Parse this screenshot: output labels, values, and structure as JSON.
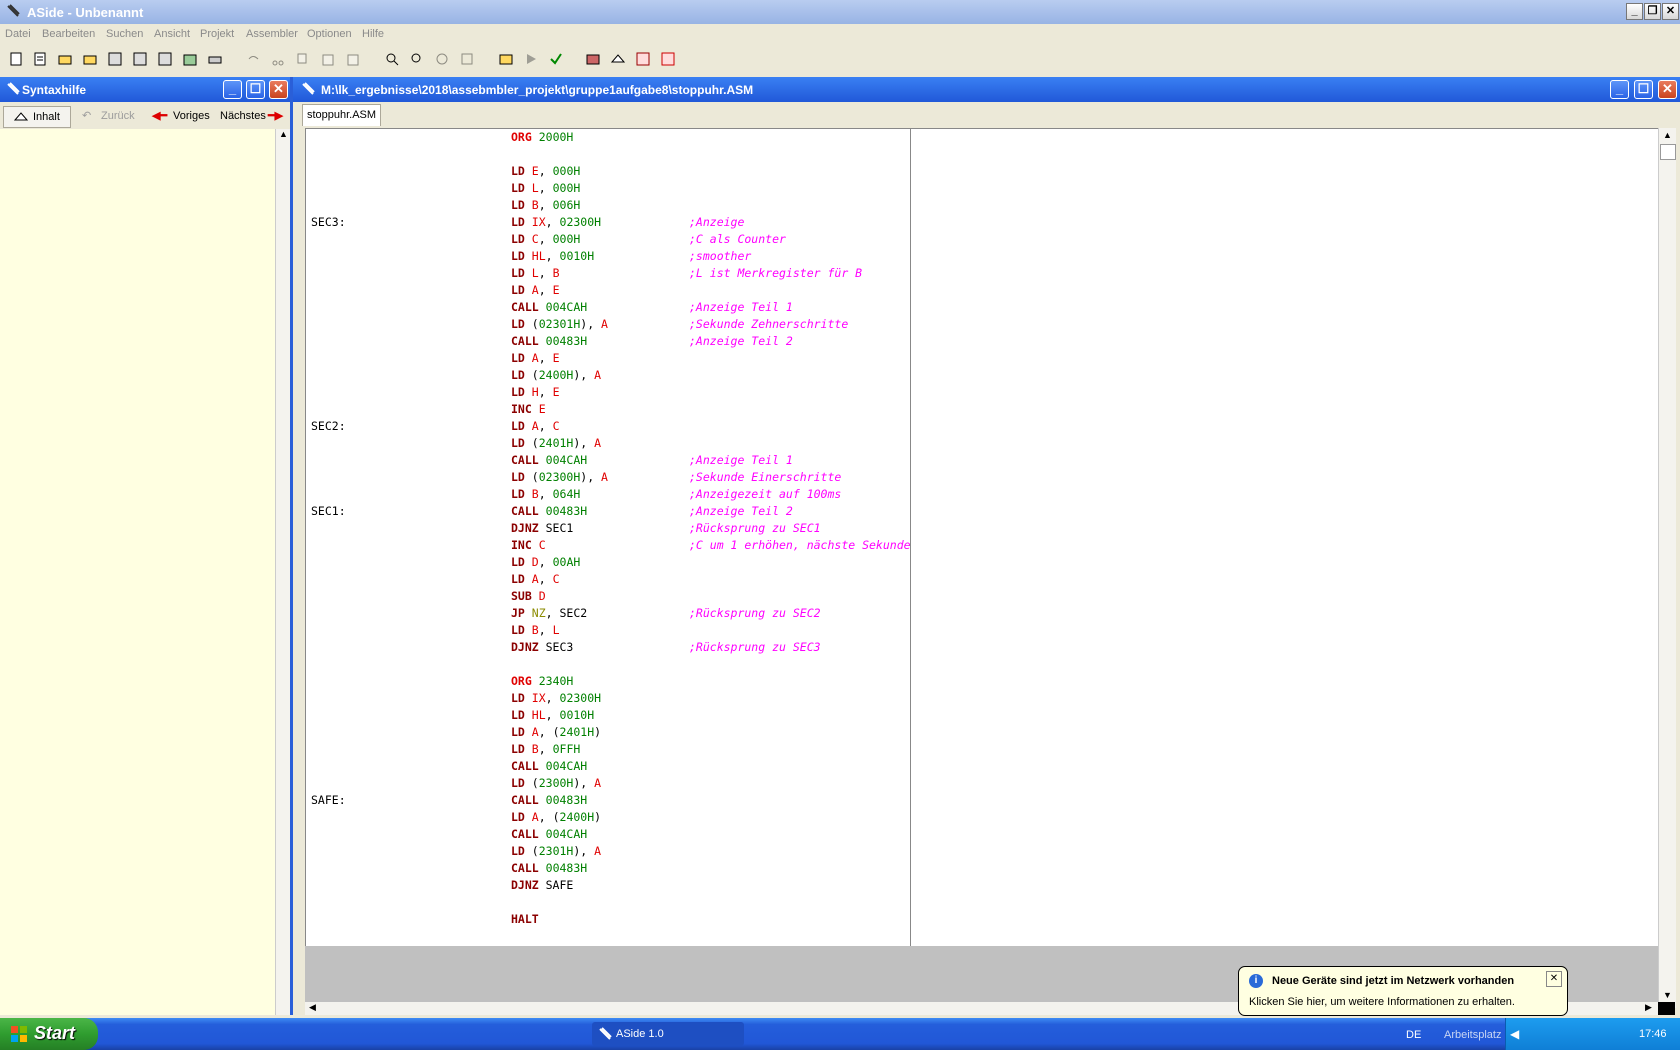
{
  "window": {
    "title": "ASide - Unbenannt"
  },
  "menu": [
    "Datei",
    "Bearbeiten",
    "Suchen",
    "Ansicht",
    "Projekt",
    "Assembler",
    "Optionen",
    "Hilfe"
  ],
  "side_panel": {
    "title": "Syntaxhilfe",
    "buttons": {
      "contents": "Inhalt",
      "back": "Zurück",
      "prev": "Voriges",
      "next": "Nächstes"
    }
  },
  "editor": {
    "title": "M:\\lk_ergebnisse\\2018\\assebmbler_projekt\\gruppe1aufgabe8\\stoppuhr.ASM",
    "tab": "stoppuhr.ASM",
    "lines": [
      {
        "label": "",
        "parts": [
          [
            "kwr",
            "ORG"
          ],
          [
            "sp",
            " "
          ],
          [
            "num",
            "2000H"
          ]
        ],
        "comment": ""
      },
      {
        "label": "",
        "parts": [],
        "comment": ""
      },
      {
        "label": "",
        "parts": [
          [
            "kw",
            "LD"
          ],
          [
            "sp",
            " "
          ],
          [
            "reg",
            "E"
          ],
          [
            "sp",
            ", "
          ],
          [
            "num",
            "000H"
          ]
        ],
        "comment": ""
      },
      {
        "label": "",
        "parts": [
          [
            "kw",
            "LD"
          ],
          [
            "sp",
            " "
          ],
          [
            "reg",
            "L"
          ],
          [
            "sp",
            ", "
          ],
          [
            "num",
            "000H"
          ]
        ],
        "comment": ""
      },
      {
        "label": "",
        "parts": [
          [
            "kw",
            "LD"
          ],
          [
            "sp",
            " "
          ],
          [
            "reg",
            "B"
          ],
          [
            "sp",
            ", "
          ],
          [
            "num",
            "006H"
          ]
        ],
        "comment": ""
      },
      {
        "label": "SEC3:",
        "parts": [
          [
            "kw",
            "LD"
          ],
          [
            "sp",
            " "
          ],
          [
            "reg",
            "IX"
          ],
          [
            "sp",
            ", "
          ],
          [
            "num",
            "02300H"
          ]
        ],
        "comment": ";Anzeige"
      },
      {
        "label": "",
        "parts": [
          [
            "kw",
            "LD"
          ],
          [
            "sp",
            " "
          ],
          [
            "reg",
            "C"
          ],
          [
            "sp",
            ", "
          ],
          [
            "num",
            "000H"
          ]
        ],
        "comment": ";C als Counter"
      },
      {
        "label": "",
        "parts": [
          [
            "kw",
            "LD"
          ],
          [
            "sp",
            " "
          ],
          [
            "reg",
            "HL"
          ],
          [
            "sp",
            ", "
          ],
          [
            "num",
            "0010H"
          ]
        ],
        "comment": ";smoother"
      },
      {
        "label": "",
        "parts": [
          [
            "kw",
            "LD"
          ],
          [
            "sp",
            " "
          ],
          [
            "reg",
            "L"
          ],
          [
            "sp",
            ", "
          ],
          [
            "reg",
            "B"
          ]
        ],
        "comment": ";L ist Merkregister für B"
      },
      {
        "label": "",
        "parts": [
          [
            "kw",
            "LD"
          ],
          [
            "sp",
            " "
          ],
          [
            "reg",
            "A"
          ],
          [
            "sp",
            ", "
          ],
          [
            "reg",
            "E"
          ]
        ],
        "comment": ""
      },
      {
        "label": "",
        "parts": [
          [
            "kw",
            "CALL"
          ],
          [
            "sp",
            " "
          ],
          [
            "num",
            "004CAH"
          ]
        ],
        "comment": ";Anzeige Teil 1"
      },
      {
        "label": "",
        "parts": [
          [
            "kw",
            "LD"
          ],
          [
            "sp",
            " ("
          ],
          [
            "num",
            "02301H"
          ],
          [
            "sp",
            "), "
          ],
          [
            "reg",
            "A"
          ]
        ],
        "comment": ";Sekunde Zehnerschritte"
      },
      {
        "label": "",
        "parts": [
          [
            "kw",
            "CALL"
          ],
          [
            "sp",
            " "
          ],
          [
            "num",
            "00483H"
          ]
        ],
        "comment": ";Anzeige Teil 2"
      },
      {
        "label": "",
        "parts": [
          [
            "kw",
            "LD"
          ],
          [
            "sp",
            " "
          ],
          [
            "reg",
            "A"
          ],
          [
            "sp",
            ", "
          ],
          [
            "reg",
            "E"
          ]
        ],
        "comment": ""
      },
      {
        "label": "",
        "parts": [
          [
            "kw",
            "LD"
          ],
          [
            "sp",
            " ("
          ],
          [
            "num",
            "2400H"
          ],
          [
            "sp",
            "), "
          ],
          [
            "reg",
            "A"
          ]
        ],
        "comment": ""
      },
      {
        "label": "",
        "parts": [
          [
            "kw",
            "LD"
          ],
          [
            "sp",
            " "
          ],
          [
            "reg",
            "H"
          ],
          [
            "sp",
            ", "
          ],
          [
            "reg",
            "E"
          ]
        ],
        "comment": ""
      },
      {
        "label": "",
        "parts": [
          [
            "kw",
            "INC"
          ],
          [
            "sp",
            " "
          ],
          [
            "reg",
            "E"
          ]
        ],
        "comment": ""
      },
      {
        "label": "SEC2:",
        "parts": [
          [
            "kw",
            "LD"
          ],
          [
            "sp",
            " "
          ],
          [
            "reg",
            "A"
          ],
          [
            "sp",
            ", "
          ],
          [
            "reg",
            "C"
          ]
        ],
        "comment": ""
      },
      {
        "label": "",
        "parts": [
          [
            "kw",
            "LD"
          ],
          [
            "sp",
            " ("
          ],
          [
            "num",
            "2401H"
          ],
          [
            "sp",
            "), "
          ],
          [
            "reg",
            "A"
          ]
        ],
        "comment": ""
      },
      {
        "label": "",
        "parts": [
          [
            "kw",
            "CALL"
          ],
          [
            "sp",
            " "
          ],
          [
            "num",
            "004CAH"
          ]
        ],
        "comment": ";Anzeige Teil 1"
      },
      {
        "label": "",
        "parts": [
          [
            "kw",
            "LD"
          ],
          [
            "sp",
            " ("
          ],
          [
            "num",
            "02300H"
          ],
          [
            "sp",
            "), "
          ],
          [
            "reg",
            "A"
          ]
        ],
        "comment": ";Sekunde Einerschritte"
      },
      {
        "label": "",
        "parts": [
          [
            "kw",
            "LD"
          ],
          [
            "sp",
            " "
          ],
          [
            "reg",
            "B"
          ],
          [
            "sp",
            ", "
          ],
          [
            "num",
            "064H"
          ]
        ],
        "comment": ";Anzeigezeit auf 100ms"
      },
      {
        "label": "SEC1:",
        "parts": [
          [
            "kw",
            "CALL"
          ],
          [
            "sp",
            " "
          ],
          [
            "num",
            "00483H"
          ]
        ],
        "comment": ";Anzeige Teil 2"
      },
      {
        "label": "",
        "parts": [
          [
            "kw",
            "DJNZ"
          ],
          [
            "sp",
            " SEC1"
          ]
        ],
        "comment": ";Rücksprung zu SEC1"
      },
      {
        "label": "",
        "parts": [
          [
            "kw",
            "INC"
          ],
          [
            "sp",
            " "
          ],
          [
            "reg",
            "C"
          ]
        ],
        "comment": ";C um 1 erhöhen, nächste Sekunde"
      },
      {
        "label": "",
        "parts": [
          [
            "kw",
            "LD"
          ],
          [
            "sp",
            " "
          ],
          [
            "reg",
            "D"
          ],
          [
            "sp",
            ", "
          ],
          [
            "num",
            "00AH"
          ]
        ],
        "comment": ""
      },
      {
        "label": "",
        "parts": [
          [
            "kw",
            "LD"
          ],
          [
            "sp",
            " "
          ],
          [
            "reg",
            "A"
          ],
          [
            "sp",
            ", "
          ],
          [
            "reg",
            "C"
          ]
        ],
        "comment": ""
      },
      {
        "label": "",
        "parts": [
          [
            "kw",
            "SUB"
          ],
          [
            "sp",
            " "
          ],
          [
            "reg",
            "D"
          ]
        ],
        "comment": ""
      },
      {
        "label": "",
        "parts": [
          [
            "kw",
            "JP"
          ],
          [
            "sp",
            " "
          ],
          [
            "cc",
            "NZ"
          ],
          [
            "sp",
            ", SEC2"
          ]
        ],
        "comment": ";Rücksprung zu SEC2"
      },
      {
        "label": "",
        "parts": [
          [
            "kw",
            "LD"
          ],
          [
            "sp",
            " "
          ],
          [
            "reg",
            "B"
          ],
          [
            "sp",
            ", "
          ],
          [
            "reg",
            "L"
          ]
        ],
        "comment": ""
      },
      {
        "label": "",
        "parts": [
          [
            "kw",
            "DJNZ"
          ],
          [
            "sp",
            " SEC3"
          ]
        ],
        "comment": ";Rücksprung zu SEC3"
      },
      {
        "label": "",
        "parts": [],
        "comment": ""
      },
      {
        "label": "",
        "parts": [
          [
            "kwr",
            "ORG"
          ],
          [
            "sp",
            " "
          ],
          [
            "num",
            "2340H"
          ]
        ],
        "comment": ""
      },
      {
        "label": "",
        "parts": [
          [
            "kw",
            "LD"
          ],
          [
            "sp",
            " "
          ],
          [
            "reg",
            "IX"
          ],
          [
            "sp",
            ", "
          ],
          [
            "num",
            "02300H"
          ]
        ],
        "comment": ""
      },
      {
        "label": "",
        "parts": [
          [
            "kw",
            "LD"
          ],
          [
            "sp",
            " "
          ],
          [
            "reg",
            "HL"
          ],
          [
            "sp",
            ", "
          ],
          [
            "num",
            "0010H"
          ]
        ],
        "comment": ""
      },
      {
        "label": "",
        "parts": [
          [
            "kw",
            "LD"
          ],
          [
            "sp",
            " "
          ],
          [
            "reg",
            "A"
          ],
          [
            "sp",
            ", ("
          ],
          [
            "num",
            "2401H"
          ],
          [
            "sp",
            ")"
          ]
        ],
        "comment": ""
      },
      {
        "label": "",
        "parts": [
          [
            "kw",
            "LD"
          ],
          [
            "sp",
            " "
          ],
          [
            "reg",
            "B"
          ],
          [
            "sp",
            ", "
          ],
          [
            "num",
            "0FFH"
          ]
        ],
        "comment": ""
      },
      {
        "label": "",
        "parts": [
          [
            "kw",
            "CALL"
          ],
          [
            "sp",
            " "
          ],
          [
            "num",
            "004CAH"
          ]
        ],
        "comment": ""
      },
      {
        "label": "",
        "parts": [
          [
            "kw",
            "LD"
          ],
          [
            "sp",
            " ("
          ],
          [
            "num",
            "2300H"
          ],
          [
            "sp",
            "), "
          ],
          [
            "reg",
            "A"
          ]
        ],
        "comment": ""
      },
      {
        "label": "SAFE:",
        "parts": [
          [
            "kw",
            "CALL"
          ],
          [
            "sp",
            " "
          ],
          [
            "num",
            "00483H"
          ]
        ],
        "comment": ""
      },
      {
        "label": "",
        "parts": [
          [
            "kw",
            "LD"
          ],
          [
            "sp",
            " "
          ],
          [
            "reg",
            "A"
          ],
          [
            "sp",
            ", ("
          ],
          [
            "num",
            "2400H"
          ],
          [
            "sp",
            ")"
          ]
        ],
        "comment": ""
      },
      {
        "label": "",
        "parts": [
          [
            "kw",
            "CALL"
          ],
          [
            "sp",
            " "
          ],
          [
            "num",
            "004CAH"
          ]
        ],
        "comment": ""
      },
      {
        "label": "",
        "parts": [
          [
            "kw",
            "LD"
          ],
          [
            "sp",
            " ("
          ],
          [
            "num",
            "2301H"
          ],
          [
            "sp",
            "), "
          ],
          [
            "reg",
            "A"
          ]
        ],
        "comment": ""
      },
      {
        "label": "",
        "parts": [
          [
            "kw",
            "CALL"
          ],
          [
            "sp",
            " "
          ],
          [
            "num",
            "00483H"
          ]
        ],
        "comment": ""
      },
      {
        "label": "",
        "parts": [
          [
            "kw",
            "DJNZ"
          ],
          [
            "sp",
            " SAFE"
          ]
        ],
        "comment": ""
      },
      {
        "label": "",
        "parts": [],
        "comment": ""
      },
      {
        "label": "",
        "parts": [
          [
            "kw",
            "HALT"
          ]
        ],
        "comment": ""
      }
    ]
  },
  "taskbar": {
    "start": "Start",
    "active_task": "ASide 1.0",
    "language": "DE",
    "toolbar_label": "Arbeitsplatz",
    "clock": "17:46"
  },
  "notification": {
    "title": "Neue Geräte sind jetzt im Netzwerk vorhanden",
    "body": "Klicken Sie hier, um weitere Informationen zu erhalten."
  }
}
